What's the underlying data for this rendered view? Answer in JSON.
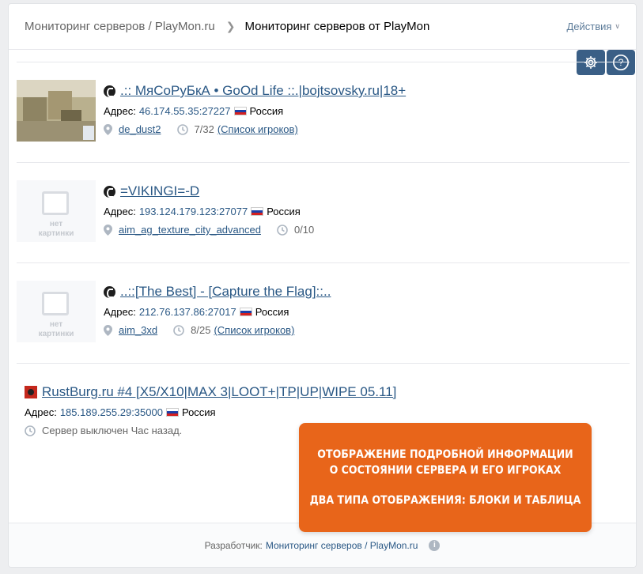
{
  "header": {
    "breadcrumb_root": "Мониторинг серверов / PlayMon.ru",
    "breadcrumb_current": "Мониторинг серверов от PlayMon",
    "actions_label": "Действия"
  },
  "toolbar": {
    "settings_icon": "gear-icon",
    "help_label": "?"
  },
  "servers": [
    {
      "title": ".:: МяСоРуБкА • GoOd Life ::.|bojtsovsky.ru|18+",
      "address_label": "Адрес:",
      "address": "46.174.55.35:27227",
      "country": "Россия",
      "map": "de_dust2",
      "players": "7/32",
      "players_link": "(Список игроков)",
      "thumb": "map-screenshot"
    },
    {
      "title": "=VIKINGI=-D",
      "address_label": "Адрес:",
      "address": "193.124.179.123:27077",
      "country": "Россия",
      "map": "aim_ag_texture_city_advanced",
      "players": "0/10",
      "nopic_line1": "нет",
      "nopic_line2": "картинки"
    },
    {
      "title": "..::[The Best] - [Capture the Flag]::..",
      "address_label": "Адрес:",
      "address": "212.76.137.86:27017",
      "country": "Россия",
      "map": "aim_3xd",
      "players": "8/25",
      "players_link": "(Список игроков)",
      "nopic_line1": "нет",
      "nopic_line2": "картинки"
    },
    {
      "title": "RustBurg.ru #4 [X5/X10|MAX 3|LOOT+|TP|UP|WIPE 05.11]",
      "address_label": "Адрес:",
      "address": "185.189.255.29:35000",
      "country": "Россия",
      "status": "Сервер выключен Час назад."
    }
  ],
  "promo": {
    "line1": "ОТОБРАЖЕНИЕ ПОДРОБНОЙ ИНФОРМАЦИИ",
    "line2": "О СОСТОЯНИИ СЕРВЕРА И ЕГО ИГРОКАХ",
    "line3": "ДВА ТИПА ОТОБРАЖЕНИЯ: БЛОКИ И ТАБЛИЦА"
  },
  "footer": {
    "developer_label": "Разработчик:",
    "developer_link": "Мониторинг серверов / PlayMon.ru",
    "info_glyph": "i"
  },
  "colors": {
    "link": "#2a5885",
    "button": "#3a5f86",
    "promo": "#e8651a"
  }
}
